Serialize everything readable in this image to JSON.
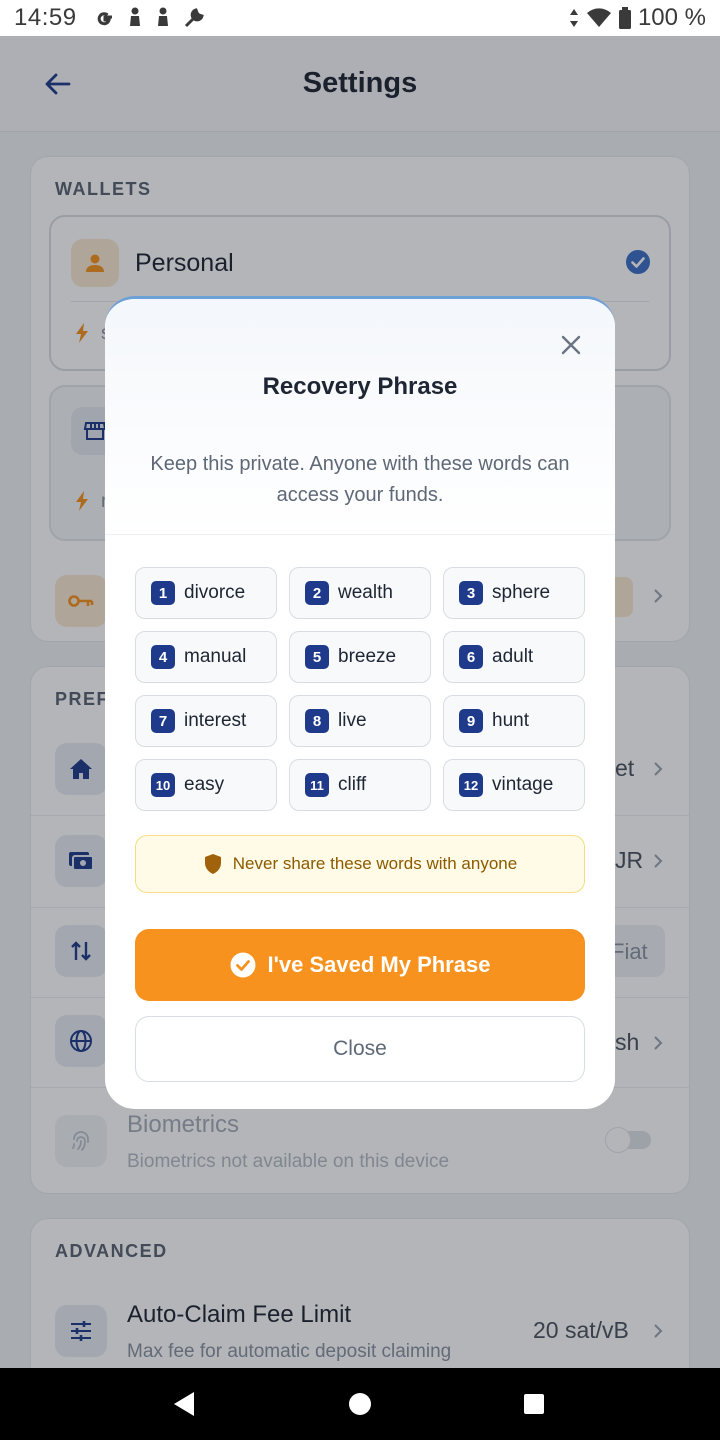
{
  "status_bar": {
    "time": "14:59",
    "battery": "100 %"
  },
  "app_bar": {
    "title": "Settings"
  },
  "wallets": {
    "section_label": "WALLETS",
    "items": [
      {
        "name": "Personal",
        "sub_fragment": "s"
      },
      {
        "sub_fragment": "n"
      }
    ]
  },
  "preferences": {
    "section_label_fragment": "PREF",
    "rows": [
      {
        "icon": "home-icon",
        "value_fragment": "et"
      },
      {
        "icon": "currency-icon",
        "value_fragment": "JR"
      },
      {
        "icon": "swap-icon",
        "value_fragment": "Fiat"
      },
      {
        "icon": "globe-icon",
        "value_fragment": "sh"
      }
    ],
    "biometrics": {
      "title": "Biometrics",
      "subtitle": "Biometrics not available on this device"
    }
  },
  "advanced": {
    "section_label": "ADVANCED",
    "fee_limit": {
      "title": "Auto-Claim Fee Limit",
      "subtitle": "Max fee for automatic deposit claiming",
      "value": "20 sat/vB"
    }
  },
  "modal": {
    "title": "Recovery Phrase",
    "description": "Keep this private. Anyone with these words can access your funds.",
    "words": [
      {
        "n": "1",
        "w": "divorce"
      },
      {
        "n": "2",
        "w": "wealth"
      },
      {
        "n": "3",
        "w": "sphere"
      },
      {
        "n": "4",
        "w": "manual"
      },
      {
        "n": "5",
        "w": "breeze"
      },
      {
        "n": "6",
        "w": "adult"
      },
      {
        "n": "7",
        "w": "interest"
      },
      {
        "n": "8",
        "w": "live"
      },
      {
        "n": "9",
        "w": "hunt"
      },
      {
        "n": "10",
        "w": "easy"
      },
      {
        "n": "11",
        "w": "cliff"
      },
      {
        "n": "12",
        "w": "vintage"
      }
    ],
    "warning": "Never share these words with anyone",
    "primary_label": "I've Saved My Phrase",
    "secondary_label": "Close"
  },
  "colors": {
    "accent": "#f7921e",
    "word_badge": "#1f3a8a",
    "warning_bg": "#fffbe6",
    "warning_text": "#8c5a00"
  }
}
